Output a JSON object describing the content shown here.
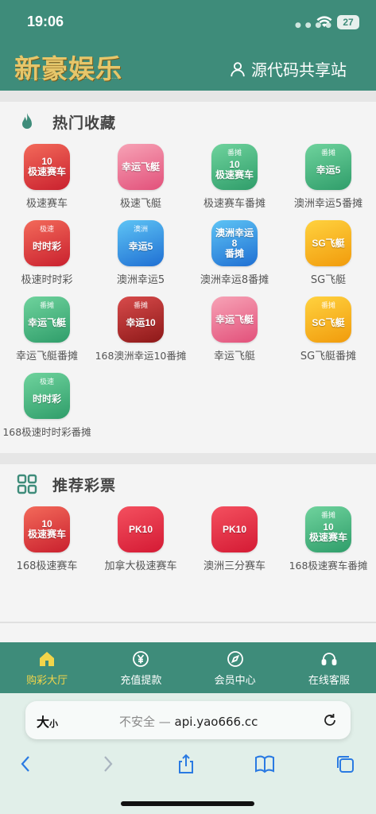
{
  "status": {
    "time": "19:06",
    "battery": "27",
    "colors": {
      "bar": "#3e8c7a"
    }
  },
  "header": {
    "logo": "新豪娱乐",
    "site_link": "源代码共享站"
  },
  "sections": [
    {
      "title": "热门收藏",
      "icon": "flame-icon",
      "items": [
        {
          "label": "极速赛车",
          "icon_text": "10\n极速赛车",
          "badge": "",
          "color": "red"
        },
        {
          "label": "极速飞艇",
          "icon_text": "幸运飞艇",
          "badge": "",
          "color": "pink"
        },
        {
          "label": "极速赛车番摊",
          "icon_text": "10\n极速赛车",
          "badge": "番摊",
          "color": "green"
        },
        {
          "label": "澳洲幸运5番摊",
          "icon_text": "幸运5",
          "badge": "番摊",
          "color": "green"
        },
        {
          "label": "极速时时彩",
          "icon_text": "时时彩",
          "badge": "极速",
          "color": "red"
        },
        {
          "label": "澳洲幸运5",
          "icon_text": "幸运5",
          "badge": "澳洲",
          "color": "blue"
        },
        {
          "label": "澳洲幸运8番摊",
          "icon_text": "澳洲幸运8\n番摊",
          "badge": "",
          "color": "blue"
        },
        {
          "label": "SG飞艇",
          "icon_text": "SG飞艇",
          "badge": "",
          "color": "yellow"
        },
        {
          "label": "幸运飞艇番摊",
          "icon_text": "幸运飞艇",
          "badge": "番摊",
          "color": "green"
        },
        {
          "label": "168澳洲幸运10番摊",
          "icon_text": "幸运10",
          "badge": "番摊",
          "color": "dred"
        },
        {
          "label": "幸运飞艇",
          "icon_text": "幸运飞艇",
          "badge": "",
          "color": "pink"
        },
        {
          "label": "SG飞艇番摊",
          "icon_text": "SG飞艇",
          "badge": "番摊",
          "color": "yellow"
        },
        {
          "label": "168极速时时彩番摊",
          "icon_text": "时时彩",
          "badge": "极速",
          "color": "green"
        }
      ]
    },
    {
      "title": "推荐彩票",
      "icon": "grid-icon",
      "items": [
        {
          "label": "168极速赛车",
          "icon_text": "10\n极速赛车",
          "badge": "",
          "color": "red"
        },
        {
          "label": "加拿大极速赛车",
          "icon_text": "PK10",
          "badge": "",
          "color": "scarlet"
        },
        {
          "label": "澳洲三分赛车",
          "icon_text": "PK10",
          "badge": "",
          "color": "scarlet"
        },
        {
          "label": "168极速赛车番摊",
          "icon_text": "10\n极速赛车",
          "badge": "番摊",
          "color": "green"
        }
      ]
    }
  ],
  "tabs": [
    {
      "label": "购彩大厅",
      "icon": "home-icon",
      "active": true
    },
    {
      "label": "充值提款",
      "icon": "yen-icon",
      "active": false
    },
    {
      "label": "会员中心",
      "icon": "compass-icon",
      "active": false
    },
    {
      "label": "在线客服",
      "icon": "headset-icon",
      "active": false
    }
  ],
  "safari": {
    "aa": "大",
    "aa_small": "小",
    "insecure": "不安全 — ",
    "url": "api.yao666.cc"
  }
}
